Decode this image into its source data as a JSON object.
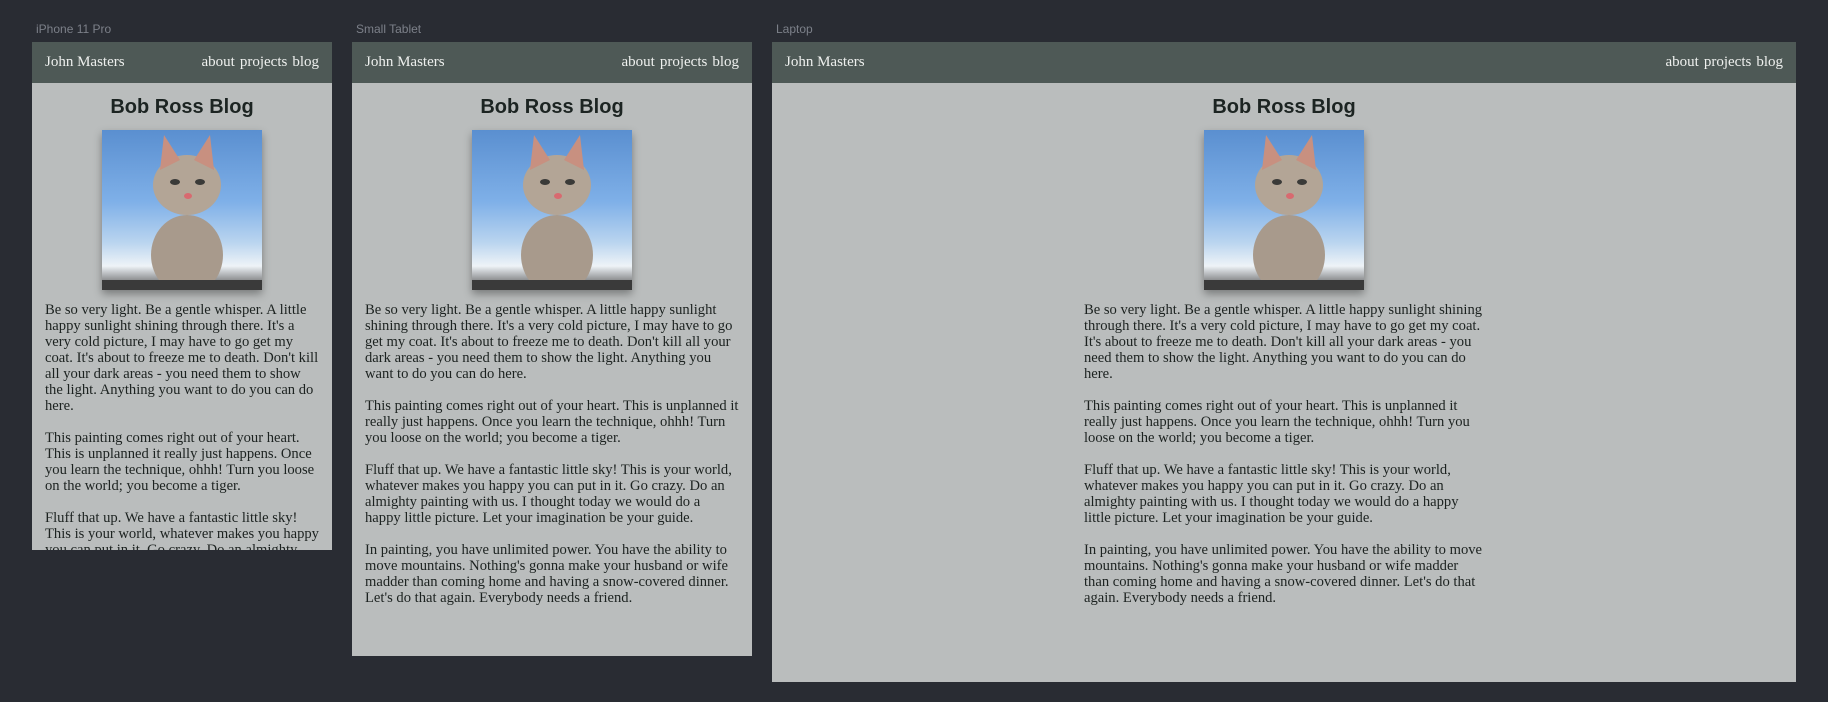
{
  "devices": [
    {
      "label": "iPhone 11 Pro"
    },
    {
      "label": "Small Tablet"
    },
    {
      "label": "Laptop"
    }
  ],
  "site": {
    "name": "John Masters",
    "nav": [
      "about",
      "projects",
      "blog"
    ],
    "title": "Bob Ross Blog",
    "image_icon": "kitten-photo",
    "paragraphs": [
      "Be so very light. Be a gentle whisper. A little happy sunlight shining through there. It's a very cold picture, I may have to go get my coat. It's about to freeze me to death. Don't kill all your dark areas - you need them to show the light. Anything you want to do you can do here.",
      "This painting comes right out of your heart. This is unplanned it really just happens. Once you learn the technique, ohhh! Turn you loose on the world; you become a tiger.",
      "Fluff that up. We have a fantastic little sky! This is your world, whatever makes you happy you can put in it. Go crazy. Do an almighty painting with us. I thought today we would do a happy little picture. Let your imagination be your guide.",
      "In painting, you have unlimited power. You have the ability to move mountains. Nothing's gonna make your husband or wife madder than coming home and having a snow-covered dinner. Let's do that again. Everybody needs a friend."
    ]
  },
  "colors": {
    "background": "#292c33",
    "nav": "#4e5956",
    "page": "#babdbd"
  }
}
